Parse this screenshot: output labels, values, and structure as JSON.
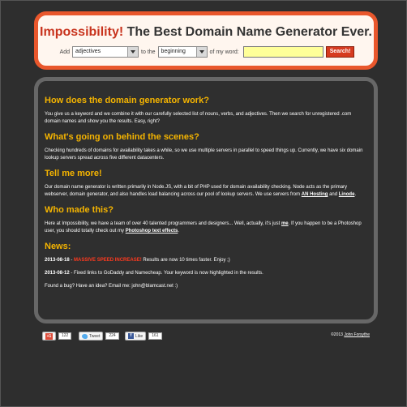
{
  "header": {
    "brand": "Impossibility!",
    "tagline": "The Best Domain Name Generator Ever.",
    "form": {
      "add_label": "Add",
      "type_value": "adjectives",
      "to_the_label": "to the",
      "position_value": "beginning",
      "of_word_label": "of my word:",
      "keyword_value": "",
      "search_label": "Search!"
    }
  },
  "sections": [
    {
      "heading": "How does the domain generator work?",
      "text": "You give us a keyword and we combine it with our carefully selected list of nouns, verbs, and adjectives. Then we search for unregistered .com domain names and show you the results. Easy, right?"
    },
    {
      "heading": "What's going on behind the scenes?",
      "text": "Checking hundreds of domains for availability takes a while, so we use multiple servers in parallel to speed things up. Currently, we have six domain lookup servers spread across five different datacenters."
    },
    {
      "heading": "Tell me more!",
      "text_before": "Our domain name generator is written primarily in Node.JS, with a bit of PHP used for domain availability checking. Node acts as the primary webserver, domain generator, and also handles load balancing across our pool of lookup servers. We use servers from ",
      "link1": "AN Hosting",
      "text_mid": " and ",
      "link2": "Linode",
      "text_after": "."
    },
    {
      "heading": "Who made this?",
      "text_before": "Here at Impossibility, we have a team of over 40 talented programmers and designers... Well, actually, it's just ",
      "link1": "me",
      "text_mid": ". If you happen to be a Photoshop user, you should totally check out my ",
      "link2": "Photoshop text effects",
      "text_after": "."
    }
  ],
  "news": {
    "heading": "News:",
    "items": [
      {
        "date": "2013-08-18",
        "sep": " - ",
        "highlight": "MASSIVE SPEED INCREASE!",
        "text": " Results are now 10 times faster. Enjoy ;)"
      },
      {
        "date": "2013-08-12",
        "sep": " - ",
        "highlight": "",
        "text": "Fixed links to GoDaddy and Namecheap. Your keyword is now highlighted in the results."
      }
    ],
    "footer_note": "Found a bug? Have an idea? Email me: john@blamcast.net :)"
  },
  "footer": {
    "gplus_icon_text": "+1",
    "gplus_count": "122",
    "tweet_label": "Tweet",
    "tweet_count": "224",
    "like_label": "Like",
    "like_count": "161",
    "copyright_prefix": "©2013 ",
    "copyright_name": "John Forsythe"
  },
  "colors": {
    "background": "#2e2e2e",
    "header_border": "#e9572c",
    "header_bg": "#fff6ef",
    "brand": "#c8331d",
    "heading": "#f5b400",
    "main_border": "#676767",
    "keyword_input": "#ffff99",
    "search_button": "#d63a1f",
    "news_highlight": "#ff3a1f"
  },
  "icons": [
    "dropdown-arrow-icon",
    "gplus-icon",
    "twitter-bird-icon",
    "facebook-icon"
  ]
}
